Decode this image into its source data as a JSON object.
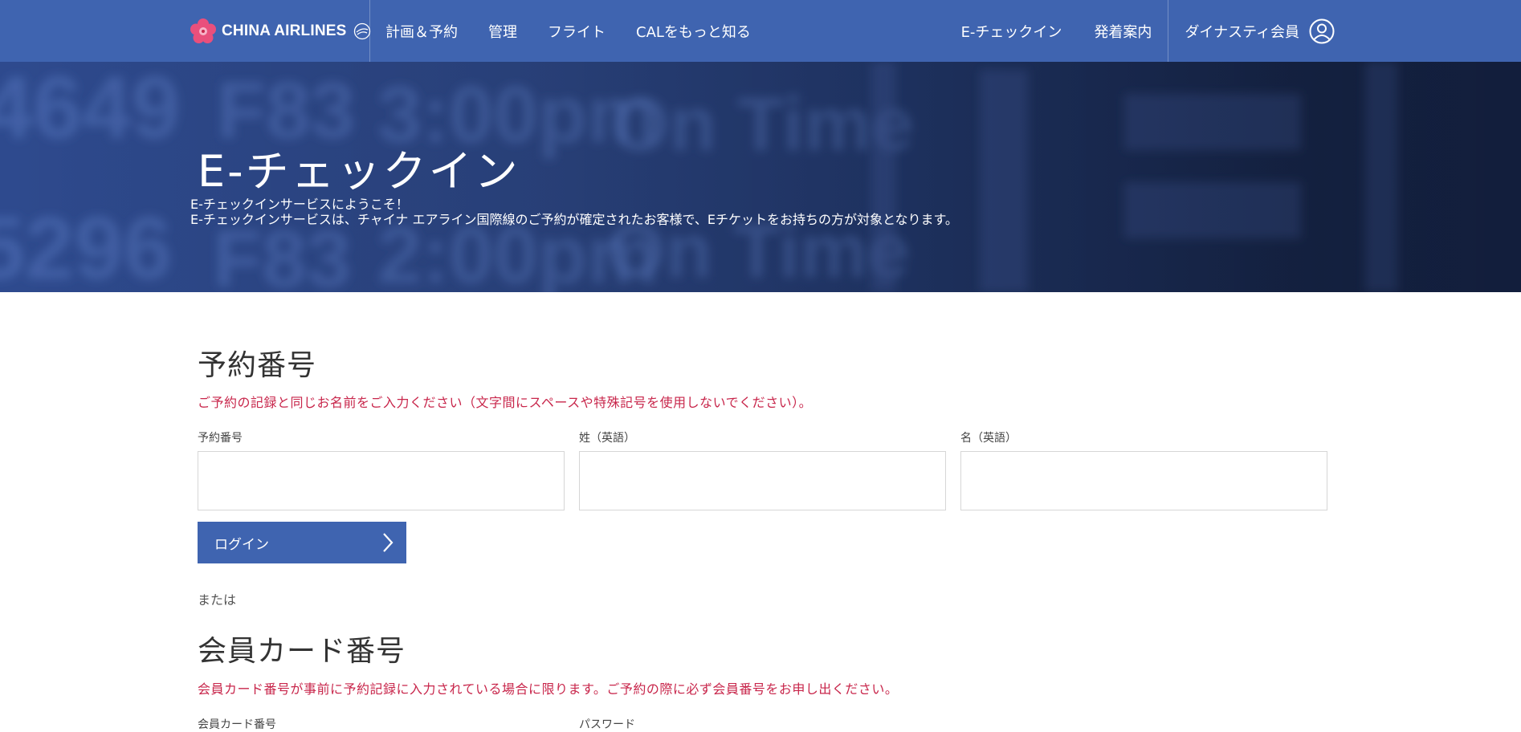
{
  "brand": {
    "name": "CHINA AIRLINES",
    "primary_color": "#3f64b0",
    "alert_color": "#c8264b"
  },
  "nav": {
    "left": [
      {
        "label": "計画＆予約"
      },
      {
        "label": "管理"
      },
      {
        "label": "フライト"
      },
      {
        "label": "CALをもっと知る"
      }
    ],
    "right": [
      {
        "label": "E-チェックイン"
      },
      {
        "label": "発着案内"
      }
    ],
    "member_label": "ダイナスティ会員"
  },
  "hero": {
    "title": "E-チェックイン",
    "line1": "E-チェックインサービスにようこそ！",
    "line2": "E-チェックインサービスは、チャイナ エアライン国際線のご予約が確定されたお客様で、Eチケットをお持ちの方が対象となります。"
  },
  "booking": {
    "title": "予約番号",
    "notice": "ご予約の記録と同じお名前をご入力ください（文字間にスペースや特殊記号を使用しないでください）。",
    "fields": [
      {
        "label": "予約番号",
        "value": ""
      },
      {
        "label": "姓（英語）",
        "value": ""
      },
      {
        "label": "名（英語）",
        "value": ""
      }
    ],
    "login_label": "ログイン",
    "or_label": "または"
  },
  "member_card": {
    "title": "会員カード番号",
    "notice": "会員カード番号が事前に予約記録に入力されている場合に限ります。ご予約の際に必ず会員番号をお申し出ください。",
    "field_labels": [
      "会員カード番号",
      "パスワード"
    ]
  }
}
